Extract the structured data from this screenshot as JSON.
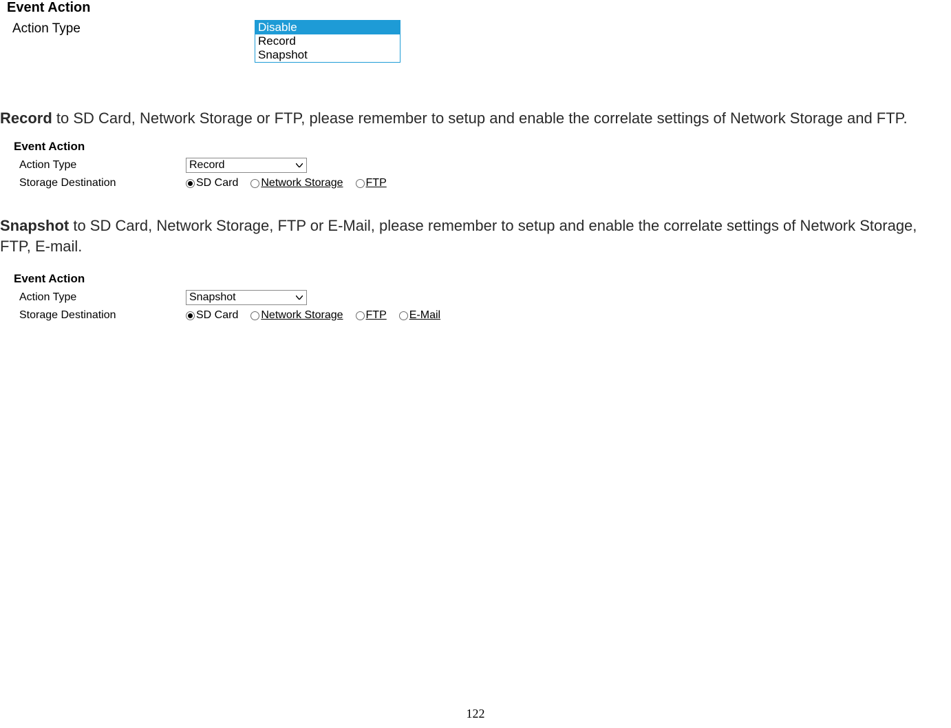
{
  "section1": {
    "heading": "Event Action",
    "label": "Action Type",
    "options": [
      "Disable",
      "Record",
      "Snapshot"
    ],
    "selected": "Disable"
  },
  "paragraph_record": {
    "bold": "Record",
    "rest": " to SD Card, Network Storage or FTP, please remember to setup and enable the correlate settings of Network Storage and FTP."
  },
  "panel_record": {
    "heading": "Event Action",
    "action_type_label": "Action Type",
    "action_type_value": "Record",
    "storage_label": "Storage Destination",
    "storage_options": [
      {
        "label": "SD Card",
        "checked": true,
        "linked": false
      },
      {
        "label": "Network Storage",
        "checked": false,
        "linked": true
      },
      {
        "label": "FTP",
        "checked": false,
        "linked": true
      }
    ]
  },
  "paragraph_snapshot": {
    "bold": "Snapshot",
    "rest": " to SD Card, Network Storage, FTP or E-Mail, please remember to setup and enable the correlate settings of Network Storage, FTP, E-mail."
  },
  "panel_snapshot": {
    "heading": "Event Action",
    "action_type_label": "Action Type",
    "action_type_value": "Snapshot",
    "storage_label": "Storage Destination",
    "storage_options": [
      {
        "label": "SD Card",
        "checked": true,
        "linked": false
      },
      {
        "label": "Network Storage",
        "checked": false,
        "linked": true
      },
      {
        "label": "FTP",
        "checked": false,
        "linked": true
      },
      {
        "label": "E-Mail",
        "checked": false,
        "linked": true
      }
    ]
  },
  "page_number": "122"
}
